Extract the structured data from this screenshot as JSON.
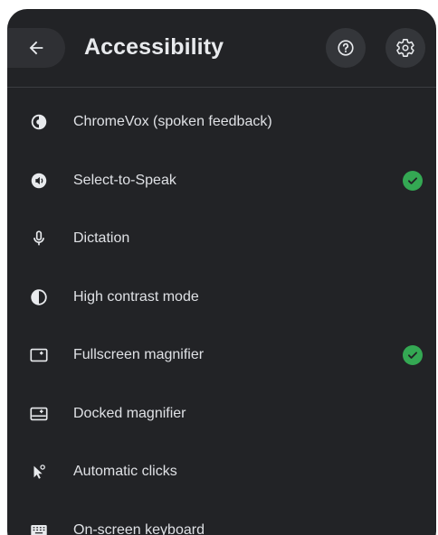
{
  "header": {
    "title": "Accessibility",
    "back_icon": "arrow-back-icon",
    "help_icon": "help-circle-icon",
    "settings_icon": "gear-icon"
  },
  "items": [
    {
      "label": "ChromeVox (spoken feedback)",
      "icon": "chromevox-icon",
      "enabled": false
    },
    {
      "label": "Select-to-Speak",
      "icon": "select-to-speak-icon",
      "enabled": true
    },
    {
      "label": "Dictation",
      "icon": "microphone-icon",
      "enabled": false
    },
    {
      "label": "High contrast mode",
      "icon": "contrast-icon",
      "enabled": false
    },
    {
      "label": "Fullscreen magnifier",
      "icon": "fullscreen-magnifier-icon",
      "enabled": true
    },
    {
      "label": "Docked magnifier",
      "icon": "docked-magnifier-icon",
      "enabled": false
    },
    {
      "label": "Automatic clicks",
      "icon": "auto-click-icon",
      "enabled": false
    },
    {
      "label": "On-screen keyboard",
      "icon": "keyboard-icon",
      "enabled": false
    }
  ],
  "colors": {
    "panel_bg": "#222326",
    "text": "#e8eaed",
    "check": "#34a853"
  }
}
